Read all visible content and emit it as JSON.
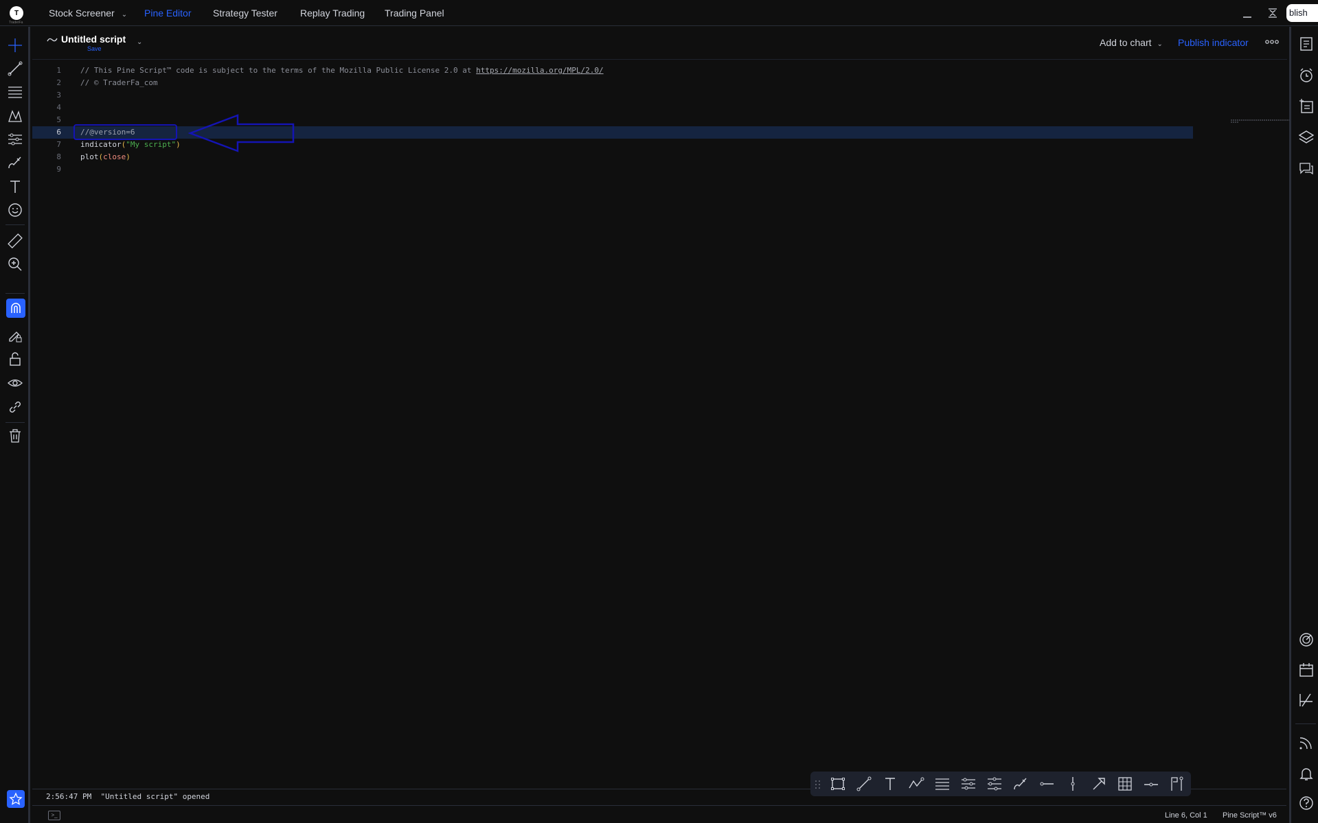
{
  "topbar": {
    "logo_text": "T",
    "logo_caption": "TraderFa",
    "tabs": [
      {
        "label": "Stock Screener",
        "has_dropdown": true,
        "active": false
      },
      {
        "label": "Pine Editor",
        "active": true
      },
      {
        "label": "Strategy Tester",
        "active": false
      },
      {
        "label": "Replay Trading",
        "active": false
      },
      {
        "label": "Trading Panel",
        "active": false
      }
    ],
    "publish_chip": "blish"
  },
  "editor": {
    "script_title": "Untitled script",
    "save_label": "Save",
    "add_to_chart": "Add to chart",
    "publish_indicator": "Publish indicator",
    "lines": [
      {
        "num": "1",
        "parts": [
          {
            "t": "// This Pine Script™ code is subject to the terms of the Mozilla Public License 2.0 at ",
            "c": "comment"
          },
          {
            "t": "https://mozilla.org/MPL/2.0/",
            "c": "link"
          }
        ]
      },
      {
        "num": "2",
        "parts": [
          {
            "t": "// © TraderFa_com",
            "c": "comment"
          }
        ]
      },
      {
        "num": "3",
        "parts": []
      },
      {
        "num": "4",
        "parts": []
      },
      {
        "num": "5",
        "parts": []
      },
      {
        "num": "6",
        "parts": [
          {
            "t": "//@version=6",
            "c": "ver"
          }
        ],
        "current": true
      },
      {
        "num": "7",
        "parts": [
          {
            "t": "indicator",
            "c": "fn"
          },
          {
            "t": "(",
            "c": "paren"
          },
          {
            "t": "\"My script\"",
            "c": "str"
          },
          {
            "t": ")",
            "c": "paren"
          }
        ]
      },
      {
        "num": "8",
        "parts": [
          {
            "t": "plot",
            "c": "fn"
          },
          {
            "t": "(",
            "c": "paren"
          },
          {
            "t": "close",
            "c": "arg"
          },
          {
            "t": ")",
            "c": "paren"
          }
        ]
      },
      {
        "num": "9",
        "parts": []
      }
    ]
  },
  "console": {
    "time": "2:56:47 PM",
    "message": "\"Untitled script\" opened"
  },
  "status": {
    "cursor": "Line 6, Col 1",
    "language": "Pine Script™ v6"
  },
  "colors": {
    "accent": "#2962ff",
    "background": "#0f0f0f",
    "current_line": "#152440",
    "annotation": "#1414b4"
  },
  "left_tools": [
    "crosshair-icon",
    "trend-line-icon",
    "fib-retracement-icon",
    "xabcd-pattern-icon",
    "prediction-tool-icon",
    "brush-icon",
    "text-icon",
    "emoji-icon",
    "ruler-icon",
    "zoom-in-icon",
    "magnet-icon",
    "lock-drawing-icon",
    "unlock-icon",
    "eye-icon",
    "link-icon",
    "trash-icon",
    "star-icon"
  ],
  "right_tools": [
    "watchlist-icon",
    "alert-clock-icon",
    "add-note-icon",
    "layers-icon",
    "chat-icon",
    "radar-icon",
    "calendar-icon",
    "ideas-icon",
    "stream-icon",
    "bell-icon",
    "help-icon"
  ],
  "draw_tools": [
    "rectangle-icon",
    "line-icon",
    "text-icon",
    "path-icon",
    "fib-icon",
    "channel-icon",
    "pitchfork-icon",
    "brush-icon",
    "horizontal-ray-icon",
    "vertical-line-icon",
    "arrow-marker-icon",
    "grid-icon",
    "price-line-icon",
    "flag-icon"
  ]
}
